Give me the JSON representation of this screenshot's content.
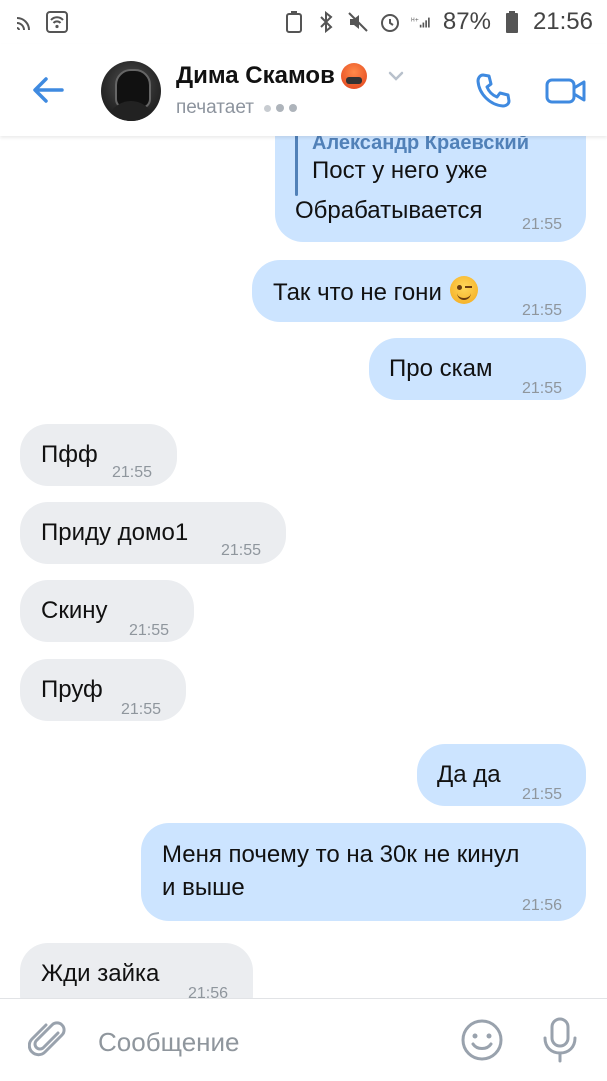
{
  "status_bar": {
    "battery": "87%",
    "time": "21:56"
  },
  "header": {
    "contact_name": "Дима Скамов",
    "status": "печатает"
  },
  "messages": [
    {
      "dir": "out",
      "reply_author": "Александр Краевский",
      "reply_text": "Пост у него уже",
      "text": "Обрабатывается",
      "time": "21:55"
    },
    {
      "dir": "out",
      "text": "Так что не гони",
      "time": "21:55"
    },
    {
      "dir": "out",
      "text": "Про скам",
      "time": "21:55"
    },
    {
      "dir": "in",
      "text": "Пфф",
      "time": "21:55"
    },
    {
      "dir": "in",
      "text": "Приду домо1",
      "time": "21:55"
    },
    {
      "dir": "in",
      "text": "Скину",
      "time": "21:55"
    },
    {
      "dir": "in",
      "text": "Пруф",
      "time": "21:55"
    },
    {
      "dir": "out",
      "text": "Да да",
      "time": "21:55"
    },
    {
      "dir": "out",
      "text_line1": "Меня почему то на 30к не кинул",
      "text_line2": "и выше",
      "time": "21:56"
    },
    {
      "dir": "in",
      "text": "Жди зайка",
      "time": "21:56"
    }
  ],
  "input": {
    "placeholder": "Сообщение"
  },
  "icons": {
    "back": "back-arrow-icon",
    "call": "phone-icon",
    "video": "video-camera-icon",
    "attach": "paperclip-icon",
    "emoji": "smiley-icon",
    "mic": "microphone-icon"
  },
  "colors": {
    "accent": "#3f8ae0",
    "outgoing_bubble": "#cce4ff",
    "incoming_bubble": "#ebedf0"
  }
}
